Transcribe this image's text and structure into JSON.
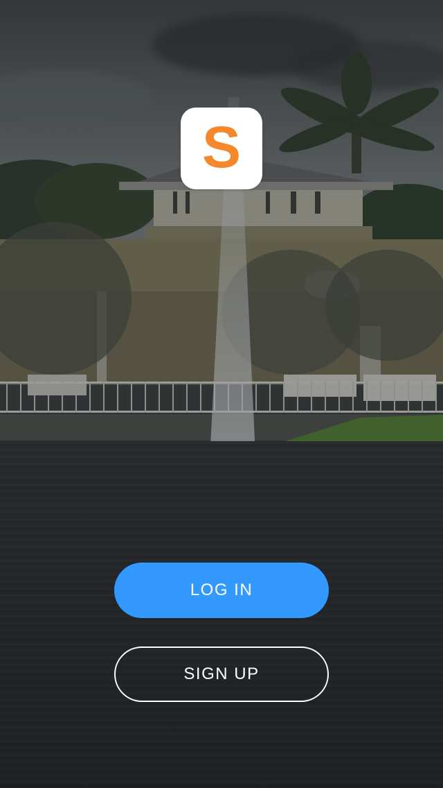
{
  "app": {
    "logo_letter": "S",
    "logo_color": "#f5882d",
    "logo_background": "#ffffff"
  },
  "actions": {
    "login_label": "LOG IN",
    "signup_label": "SIGN UP"
  },
  "colors": {
    "primary": "#3399ff",
    "outline": "#ffffff",
    "text": "#ffffff"
  },
  "background": {
    "scene": "fountain-in-pond-with-building-and-palm-trees"
  }
}
